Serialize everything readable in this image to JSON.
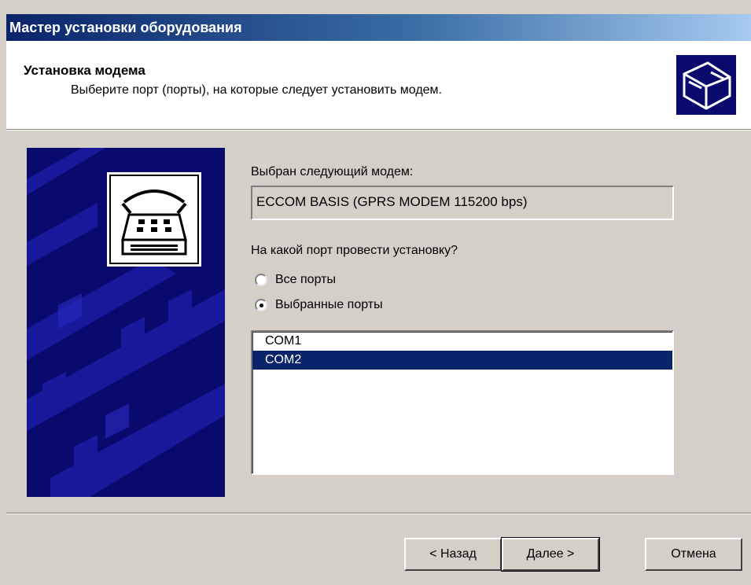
{
  "window": {
    "title": "Мастер установки оборудования"
  },
  "header": {
    "title": "Установка модема",
    "subtitle": "Выберите порт (порты), на которые следует установить модем."
  },
  "content": {
    "modem_label": "Выбран следующий модем:",
    "modem_value": "ECCOM BASIS (GPRS MODEM 115200 bps)",
    "port_question": "На какой порт провести установку?",
    "radio_all": "Все порты",
    "radio_selected": "Выбранные порты",
    "ports": [
      "COM1",
      "COM2"
    ]
  },
  "buttons": {
    "back": "< Назад",
    "next": "Далее >",
    "cancel": "Отмена"
  },
  "colors": {
    "title_gradient_start": "#0a246a",
    "selection": "#0a246a",
    "panel": "#0a0a6e"
  }
}
